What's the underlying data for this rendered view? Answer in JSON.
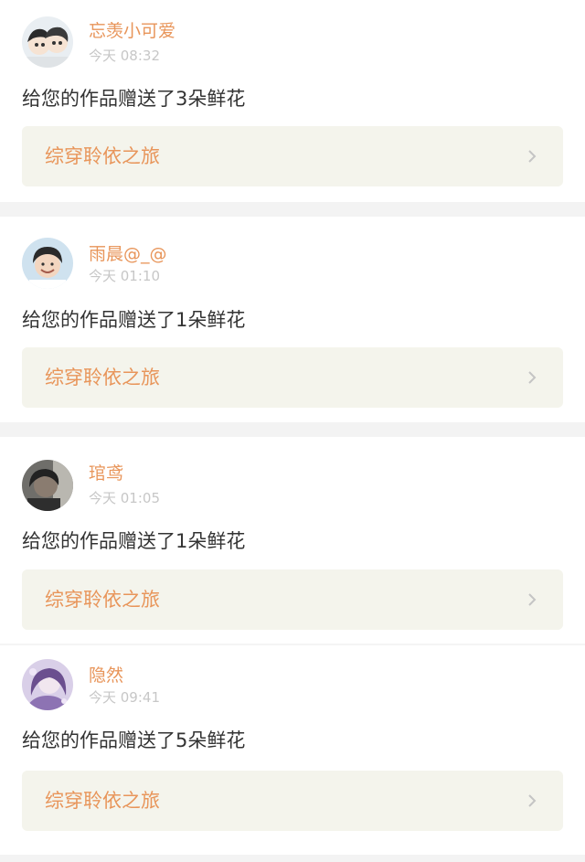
{
  "notifications": [
    {
      "username": "忘羡小可爱",
      "time": "今天 08:32",
      "message": "给您的作品赠送了3朵鲜花",
      "work_title": "综穿聆依之旅",
      "avatar_icon": "cartoon-couple-avatar"
    },
    {
      "username": "雨晨@_@",
      "time": "今天 01:10",
      "message": "给您的作品赠送了1朵鲜花",
      "work_title": "综穿聆依之旅",
      "avatar_icon": "smiling-boy-avatar"
    },
    {
      "username": "琯鸢",
      "time": "今天 01:05",
      "message": "给您的作品赠送了1朵鲜花",
      "work_title": "综穿聆依之旅",
      "avatar_icon": "dark-photo-avatar"
    },
    {
      "username": "隐然",
      "time": "今天 09:41",
      "message": "给您的作品赠送了5朵鲜花",
      "work_title": "综穿聆依之旅",
      "avatar_icon": "purple-anime-avatar"
    }
  ],
  "colors": {
    "accent": "#e8955a",
    "timestamp": "#c7c7c7",
    "link_bg": "#f4f4ec",
    "separator": "#f3f3f3"
  }
}
